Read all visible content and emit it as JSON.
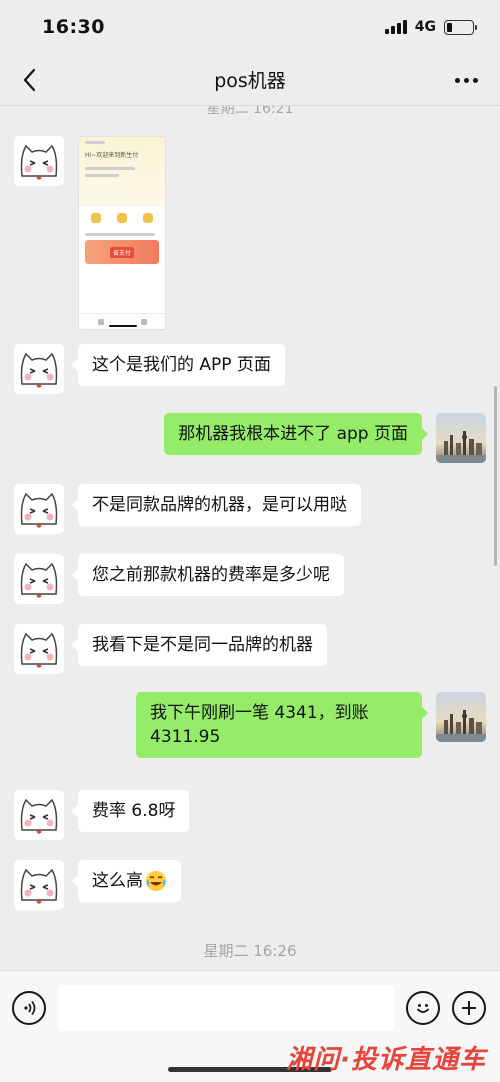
{
  "status": {
    "time": "16:30",
    "network": "4G"
  },
  "header": {
    "title": "pos机器"
  },
  "chat": {
    "top_timestamp": "星期二 16:21",
    "bottom_timestamp": "星期二 16:26",
    "screenshot": {
      "title": "Hi~欢迎来到新生付",
      "banner": "省支付"
    },
    "messages": [
      {
        "from": "them",
        "text": "这个是我们的 APP 页面"
      },
      {
        "from": "me",
        "text": "那机器我根本进不了 app 页面"
      },
      {
        "from": "them",
        "text": "不是同款品牌的机器，是可以用哒"
      },
      {
        "from": "them",
        "text": "您之前那款机器的费率是多少呢"
      },
      {
        "from": "them",
        "text": "我看下是不是同一品牌的机器"
      },
      {
        "from": "me",
        "text": "我下午刚刷一笔 4341，到账 4311.95"
      },
      {
        "from": "them",
        "text": "费率 6.8呀"
      },
      {
        "from": "them",
        "text": "这么高"
      }
    ]
  },
  "footer": {
    "watermark": "湘问·投诉直通车"
  },
  "colors": {
    "outgoing_bubble": "#95ec69",
    "incoming_bubble": "#ffffff",
    "background": "#ededed",
    "watermark": "#e6453c"
  },
  "icons": [
    "back-icon",
    "more-icon",
    "voice-icon",
    "emoji-icon",
    "plus-icon",
    "laugh-emoji-icon"
  ]
}
